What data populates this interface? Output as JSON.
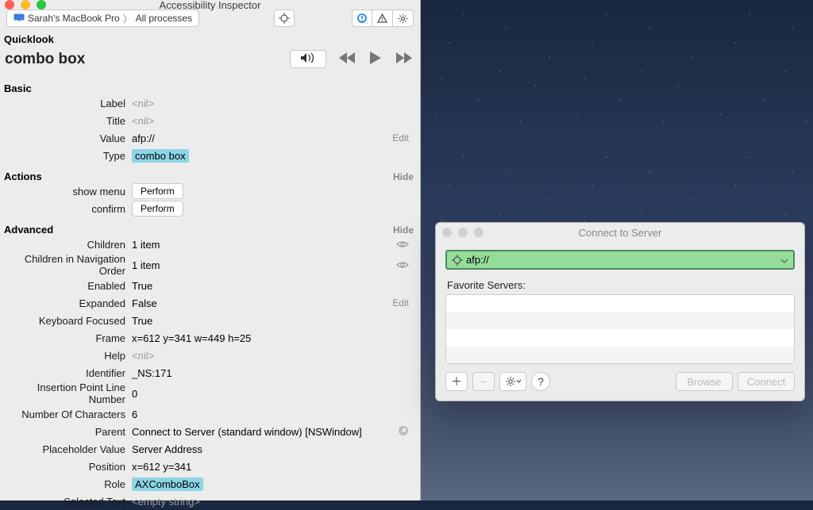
{
  "inspector": {
    "window_title": "Accessibility Inspector",
    "target_device": "Sarah's MacBook Pro",
    "target_process": "All processes",
    "quicklook_heading": "Quicklook",
    "quicklook_title": "combo box",
    "sections": {
      "basic": {
        "heading": "Basic",
        "rows": {
          "label_key": "Label",
          "label_val": "<nil>",
          "title_key": "Title",
          "title_val": "<nil>",
          "value_key": "Value",
          "value_val": "afp://",
          "value_edit": "Edit",
          "type_key": "Type",
          "type_val": "combo box"
        }
      },
      "actions": {
        "heading": "Actions",
        "toggle": "Hide",
        "rows": {
          "showmenu_key": "show menu",
          "showmenu_btn": "Perform",
          "confirm_key": "confirm",
          "confirm_btn": "Perform"
        }
      },
      "advanced": {
        "heading": "Advanced",
        "toggle": "Hide",
        "rows": {
          "children_key": "Children",
          "children_val": "1 item",
          "childnav_key": "Children in Navigation Order",
          "childnav_val": "1 item",
          "enabled_key": "Enabled",
          "enabled_val": "True",
          "expanded_key": "Expanded",
          "expanded_val": "False",
          "expanded_edit": "Edit",
          "kfocused_key": "Keyboard Focused",
          "kfocused_val": "True",
          "frame_key": "Frame",
          "frame_val": "x=612 y=341 w=449 h=25",
          "help_key": "Help",
          "help_val": "<nil>",
          "identifier_key": "Identifier",
          "identifier_val": "_NS:171",
          "ipln_key": "Insertion Point Line Number",
          "ipln_val": "0",
          "nchars_key": "Number Of Characters",
          "nchars_val": "6",
          "parent_key": "Parent",
          "parent_val": "Connect to Server (standard window) [NSWindow]",
          "placeholder_key": "Placeholder Value",
          "placeholder_val": "Server Address",
          "position_key": "Position",
          "position_val": "x=612 y=341",
          "role_key": "Role",
          "role_val": "AXComboBox",
          "seltext_key": "Selected Text",
          "seltext_val": "<empty string>"
        }
      }
    }
  },
  "connect": {
    "window_title": "Connect to Server",
    "combo_value": "afp://",
    "favorites_label": "Favorite Servers:",
    "help_label": "?",
    "browse_label": "Browse",
    "connect_label": "Connect"
  }
}
